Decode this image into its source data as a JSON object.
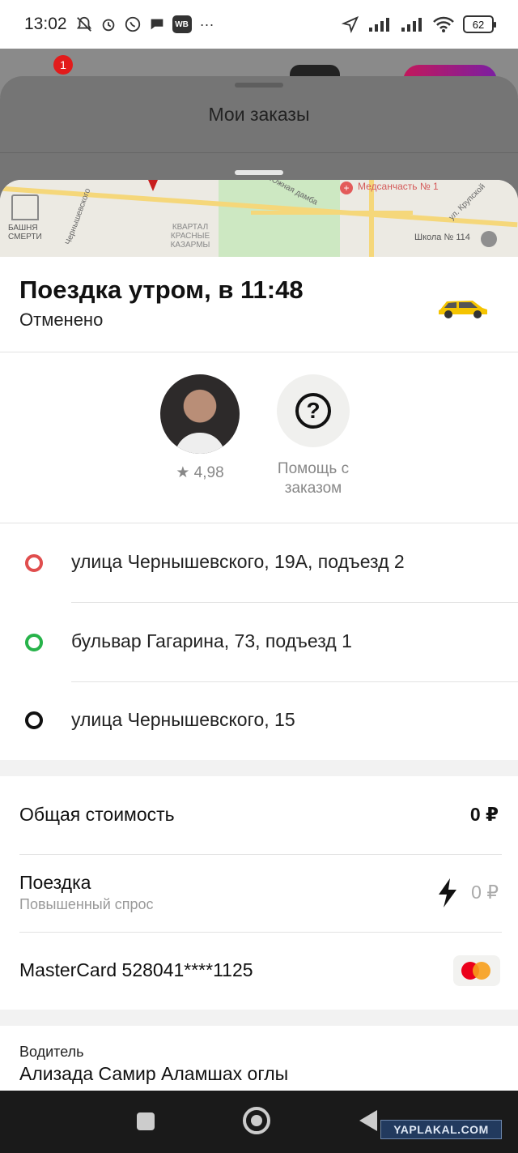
{
  "status_bar": {
    "time": "13:02",
    "battery": "62",
    "icons": [
      "mute-icon",
      "alarm-icon",
      "whatsapp-icon",
      "chat-icon",
      "wb-icon",
      "more-icon",
      "location-icon",
      "signal-icon",
      "signal-icon",
      "wifi-icon",
      "battery-icon"
    ],
    "wb_label": "WB",
    "more": "···"
  },
  "background_app": {
    "badge_count": "1"
  },
  "orders_sheet": {
    "title": "Мои заказы"
  },
  "map": {
    "labels": {
      "hospital": "Медсанчасть № 1",
      "street1": "Южная дамба",
      "street2": "ул. Крупской",
      "street3": "Чернышевского",
      "district": "КВАРТАЛ КРАСНЫЕ КАЗАРМЫ",
      "landmark": "БАШНЯ СМЕРТИ",
      "school": "Школа № 114"
    }
  },
  "trip": {
    "title": "Поездка утром, в 11:48",
    "status": "Отменено",
    "vehicle_icon": "taxi-icon"
  },
  "driver_card": {
    "rating": "★ 4,98",
    "help_label": "Помощь с заказом"
  },
  "route": [
    {
      "address": "улица Чернышевского, 19А, подъезд 2",
      "color": "#e04e4e"
    },
    {
      "address": "бульвар Гагарина, 73, подъезд 1",
      "color": "#27b34a"
    },
    {
      "address": "улица Чернышевского, 15",
      "color": "#111111"
    }
  ],
  "payment": {
    "total_label": "Общая стоимость",
    "total_value": "0 ₽",
    "ride_label": "Поездка",
    "ride_sub": "Повышенный спрос",
    "ride_value": "0 ₽",
    "card_label": "MasterCard 528041****1125"
  },
  "driver": {
    "label": "Водитель",
    "name": "Ализада Самир Аламшах оглы"
  },
  "watermark": "YAPLAKAL.COM",
  "colors": {
    "accent_yellow": "#f5c400",
    "route_red": "#e04e4e",
    "route_green": "#27b34a"
  }
}
